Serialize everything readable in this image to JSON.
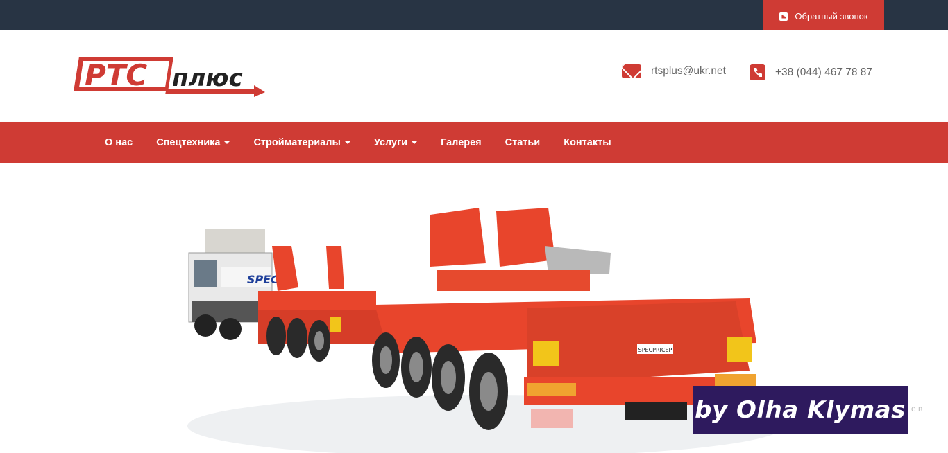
{
  "topbar": {
    "callback_label": "Обратный звонок",
    "callback_icon": "phone-square-icon"
  },
  "header": {
    "logo_text_latin": "РТС",
    "logo_text_cyrillic": "плюс",
    "email": "rtsplus@ukr.net",
    "email_icon": "envelope-icon",
    "phone": "+38 (044) 467 78 87",
    "phone_icon": "phone-square-icon"
  },
  "nav": {
    "items": [
      {
        "label": "О нас",
        "has_dropdown": false
      },
      {
        "label": "Спецтехника",
        "has_dropdown": true
      },
      {
        "label": "Стройматериалы",
        "has_dropdown": true
      },
      {
        "label": "Услуги",
        "has_dropdown": true
      },
      {
        "label": "Галерея",
        "has_dropdown": false
      },
      {
        "label": "Статьи",
        "has_dropdown": false
      },
      {
        "label": "Контакты",
        "has_dropdown": false
      }
    ]
  },
  "hero": {
    "truck_cab_text": "SPEC",
    "trailer_plate_text": "SPECPRICEP",
    "partial_text": "е в",
    "watermark": "by Olha Klymas"
  },
  "colors": {
    "topbar_bg": "#283444",
    "accent_red": "#cf3b34",
    "trailer_orange": "#e8452c",
    "watermark_bg": "#2e1a5e"
  }
}
